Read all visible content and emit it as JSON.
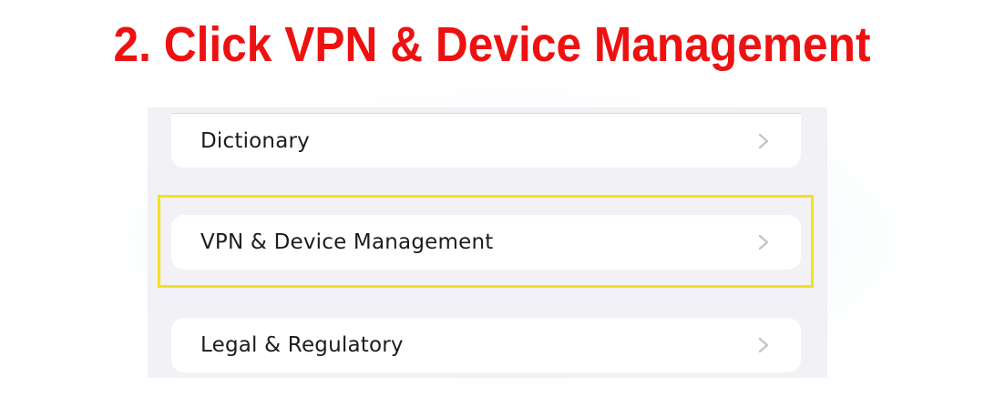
{
  "instruction": {
    "text": "2. Click VPN & Device Management",
    "color": "#ee1111"
  },
  "settings_list": {
    "items": [
      {
        "label": "Dictionary",
        "icon": "chevron-right-icon"
      },
      {
        "label": "VPN & Device Management",
        "icon": "chevron-right-icon",
        "highlighted": true
      },
      {
        "label": "Legal & Regulatory",
        "icon": "chevron-right-icon"
      }
    ]
  },
  "colors": {
    "highlight_border": "#f2e21a",
    "panel_background": "#f1f1f6",
    "cell_background": "#ffffff",
    "chevron": "#c4c4c7"
  }
}
